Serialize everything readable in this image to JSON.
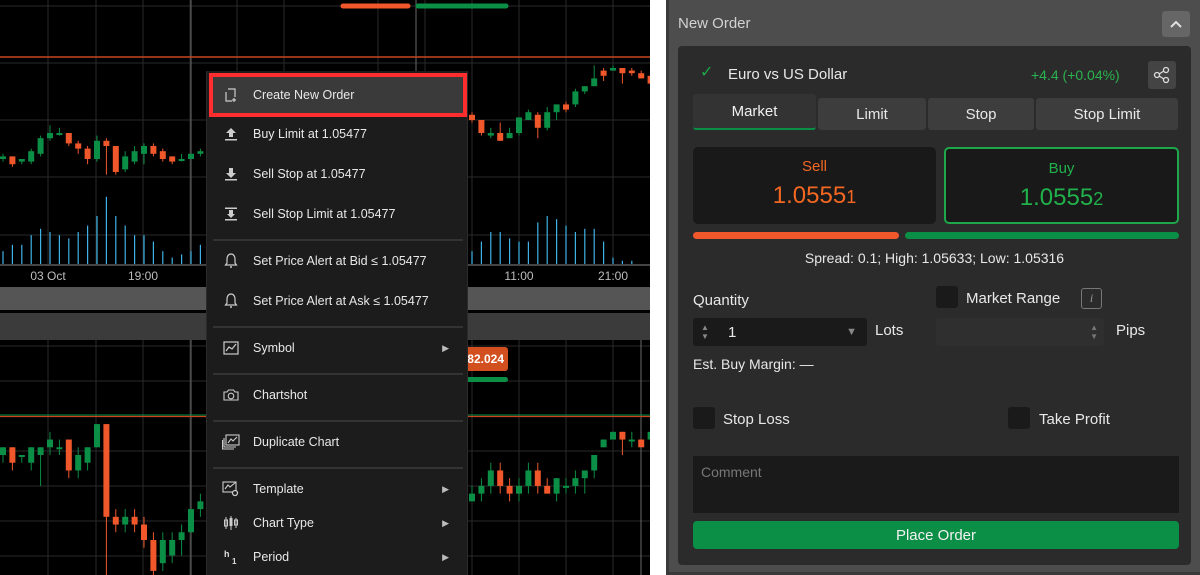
{
  "chart": {
    "colors": {
      "up": "#0b8e45",
      "down": "#f0582c",
      "volume": "#3fb3e8",
      "grid": "#2a2a2a",
      "price_line": "#c8451f"
    },
    "top_pane": {
      "time_labels": [
        "03 Oct",
        "19:00",
        "11:00",
        "21:00"
      ],
      "candles": [
        [
          1.052,
          1.0521,
          1.0519,
          1.0522
        ],
        [
          1.0521,
          1.0518,
          1.0517,
          1.0521
        ],
        [
          1.0519,
          1.052,
          1.0518,
          1.052
        ],
        [
          1.0519,
          1.0523,
          1.0518,
          1.0524
        ],
        [
          1.0522,
          1.0528,
          1.0521,
          1.0529
        ],
        [
          1.0528,
          1.053,
          1.0527,
          1.0533
        ],
        [
          1.053,
          1.053,
          1.0529,
          1.0532
        ],
        [
          1.053,
          1.0526,
          1.0525,
          1.053
        ],
        [
          1.0526,
          1.0524,
          1.0522,
          1.0527
        ],
        [
          1.0524,
          1.052,
          1.0518,
          1.0525
        ],
        [
          1.052,
          1.0527,
          1.0519,
          1.0529
        ],
        [
          1.0527,
          1.0525,
          1.0514,
          1.0528
        ],
        [
          1.0525,
          1.0515,
          1.0514,
          1.0525
        ],
        [
          1.0516,
          1.0521,
          1.0515,
          1.0523
        ],
        [
          1.0519,
          1.0523,
          1.0518,
          1.0525
        ],
        [
          1.0522,
          1.0525,
          1.0518,
          1.0526
        ],
        [
          1.0525,
          1.0522,
          1.0521,
          1.0526
        ],
        [
          1.0523,
          1.052,
          1.0519,
          1.0524
        ],
        [
          1.0521,
          1.0519,
          1.0518,
          1.0521
        ],
        [
          1.052,
          1.052,
          1.0519,
          1.0522
        ],
        [
          1.052,
          1.0522,
          1.052,
          1.0522
        ],
        [
          1.0522,
          1.0523,
          1.0521,
          1.0524
        ]
      ],
      "volumes": [
        4,
        6,
        6,
        9,
        11,
        10,
        9,
        8,
        10,
        12,
        15,
        21,
        15,
        12,
        9,
        9,
        7,
        4,
        2,
        3,
        4,
        6
      ],
      "candles_right": [
        [
          1.0537,
          1.0535,
          1.0534,
          1.0538
        ],
        [
          1.0535,
          1.053,
          1.0529,
          1.0535
        ],
        [
          1.0529,
          1.053,
          1.0528,
          1.0532
        ],
        [
          1.053,
          1.0527,
          1.0527,
          1.0534
        ],
        [
          1.0528,
          1.053,
          1.0528,
          1.0532
        ],
        [
          1.053,
          1.0536,
          1.0529,
          1.0536
        ],
        [
          1.0535,
          1.0538,
          1.0535,
          1.0539
        ],
        [
          1.0537,
          1.0532,
          1.0528,
          1.0538
        ],
        [
          1.0532,
          1.0538,
          1.0531,
          1.054
        ],
        [
          1.0538,
          1.0541,
          1.0535,
          1.0541
        ],
        [
          1.0541,
          1.0539,
          1.0538,
          1.0542
        ],
        [
          1.0541,
          1.0546,
          1.054,
          1.0547
        ],
        [
          1.0546,
          1.0548,
          1.0545,
          1.0548
        ],
        [
          1.0548,
          1.0551,
          1.0548,
          1.0556
        ],
        [
          1.0554,
          1.0552,
          1.055,
          1.0555
        ],
        [
          1.0554,
          1.0555,
          1.0554,
          1.0556
        ],
        [
          1.0555,
          1.0553,
          1.0549,
          1.0555
        ],
        [
          1.0554,
          1.0553,
          1.0552,
          1.0555
        ],
        [
          1.0553,
          1.0551,
          1.0551,
          1.0554
        ],
        [
          1.0552,
          1.0549,
          1.0548,
          1.0552
        ]
      ],
      "volumes_right": [
        4,
        7,
        10,
        10,
        8,
        7,
        7,
        13,
        15,
        14,
        12,
        10,
        11,
        11,
        7,
        2,
        1,
        1
      ]
    },
    "bottom_pane": {
      "price_tag": "82.024",
      "candles": [
        [
          82.0,
          82.01,
          81.99,
          82.01
        ],
        [
          82.01,
          81.99,
          81.98,
          82.01
        ],
        [
          82.0,
          82.0,
          81.99,
          82.0
        ],
        [
          81.99,
          82.01,
          81.98,
          82.01
        ],
        [
          82.0,
          82.01,
          81.96,
          82.01
        ],
        [
          82.01,
          82.02,
          82.0,
          82.03
        ],
        [
          82.01,
          82.01,
          82.0,
          82.02
        ],
        [
          82.02,
          81.98,
          81.97,
          82.02
        ],
        [
          81.98,
          82.0,
          81.97,
          82.01
        ],
        [
          81.99,
          82.01,
          81.98,
          82.01
        ],
        [
          82.01,
          82.04,
          82.01,
          82.04
        ],
        [
          82.04,
          81.92,
          81.78,
          82.04
        ],
        [
          81.92,
          81.91,
          81.9,
          81.93
        ],
        [
          81.91,
          81.92,
          81.9,
          81.93
        ],
        [
          81.92,
          81.91,
          81.9,
          81.93
        ],
        [
          81.91,
          81.89,
          81.88,
          81.92
        ],
        [
          81.89,
          81.85,
          81.84,
          81.9
        ],
        [
          81.86,
          81.89,
          81.85,
          81.9
        ],
        [
          81.87,
          81.89,
          81.86,
          81.9
        ],
        [
          81.89,
          81.9,
          81.87,
          81.91
        ],
        [
          81.9,
          81.93,
          81.9,
          81.93
        ],
        [
          81.93,
          81.94,
          81.92,
          81.95
        ]
      ],
      "candles_right": [
        [
          81.94,
          81.95,
          81.94,
          81.96
        ],
        [
          81.95,
          81.96,
          81.94,
          81.97
        ],
        [
          81.96,
          81.98,
          81.95,
          81.99
        ],
        [
          81.98,
          81.96,
          81.95,
          81.99
        ],
        [
          81.96,
          81.95,
          81.94,
          81.97
        ],
        [
          81.95,
          81.96,
          81.94,
          81.97
        ],
        [
          81.96,
          81.98,
          81.95,
          81.99
        ],
        [
          81.98,
          81.96,
          81.95,
          81.99
        ],
        [
          81.96,
          81.95,
          81.95,
          81.97
        ],
        [
          81.95,
          81.97,
          81.94,
          81.97
        ],
        [
          81.96,
          81.96,
          81.95,
          81.97
        ],
        [
          81.96,
          81.97,
          81.95,
          81.98
        ],
        [
          81.97,
          81.98,
          81.95,
          81.98
        ],
        [
          81.98,
          82.0,
          81.97,
          82.0
        ],
        [
          82.01,
          82.02,
          82.01,
          82.02
        ],
        [
          82.02,
          82.03,
          82.02,
          82.03
        ],
        [
          82.03,
          82.02,
          82.0,
          82.03
        ],
        [
          82.02,
          82.02,
          82.01,
          82.03
        ],
        [
          82.02,
          82.01,
          82.01,
          82.02
        ],
        [
          82.02,
          82.03,
          82.02,
          82.03
        ]
      ]
    }
  },
  "context_menu": {
    "items": [
      {
        "label": "Create New Order",
        "icon": "new-order-icon",
        "submenu": false,
        "highlighted": true
      },
      {
        "label": "Buy Limit at 1.05477",
        "icon": "buy-limit-icon",
        "submenu": false
      },
      {
        "label": "Sell Stop at 1.05477",
        "icon": "sell-stop-icon",
        "submenu": false
      },
      {
        "label": "Sell Stop Limit at 1.05477",
        "icon": "sell-stop-limit-icon",
        "submenu": false
      },
      {
        "label": "Set Price Alert at Bid ≤ 1.05477",
        "icon": "bell-icon",
        "submenu": false
      },
      {
        "label": "Set Price Alert at Ask ≤ 1.05477",
        "icon": "bell-icon",
        "submenu": false
      },
      {
        "label": "Symbol",
        "icon": "symbol-icon",
        "submenu": true
      },
      {
        "label": "Chartshot",
        "icon": "camera-icon",
        "submenu": false
      },
      {
        "label": "Duplicate Chart",
        "icon": "duplicate-chart-icon",
        "submenu": false
      },
      {
        "label": "Template",
        "icon": "template-icon",
        "submenu": true
      },
      {
        "label": "Chart Type",
        "icon": "chart-type-icon",
        "submenu": true
      },
      {
        "label": "Period",
        "icon": "period-icon",
        "submenu": true,
        "icon_text": "h1"
      }
    ],
    "submenu_arrow": "▶"
  },
  "order_panel": {
    "title": "New Order",
    "collapse_icon": "^",
    "symbol": {
      "check": "✓",
      "name": "Euro vs US Dollar",
      "change": "+4.4 (+0.04%)"
    },
    "tabs": [
      {
        "label": "Market",
        "active": true
      },
      {
        "label": "Limit",
        "active": false
      },
      {
        "label": "Stop",
        "active": false
      },
      {
        "label": "Stop Limit",
        "active": false
      }
    ],
    "sell": {
      "label": "Sell",
      "price_main": "1.0555",
      "price_pip": "1"
    },
    "buy": {
      "label": "Buy",
      "price_main": "1.0555",
      "price_pip": "2"
    },
    "sentiment": {
      "sell_fraction": 0.43,
      "buy_fraction": 0.57
    },
    "spread_text": "Spread: 0.1; High: 1.05633; Low: 1.05316",
    "quantity": {
      "label": "Quantity",
      "value": "1",
      "unit": "Lots"
    },
    "market_range": {
      "label": "Market Range",
      "checked": false,
      "info": "i",
      "value": "",
      "unit": "Pips"
    },
    "margin_text": "Est. Buy Margin: —",
    "stop_loss": {
      "label": "Stop Loss",
      "checked": false
    },
    "take_profit": {
      "label": "Take Profit",
      "checked": false
    },
    "comment": {
      "placeholder": "Comment",
      "value": ""
    },
    "place_order_label": "Place Order",
    "colors": {
      "sell": "#f26722",
      "buy": "#21b14b",
      "button": "#0b8e45"
    }
  }
}
